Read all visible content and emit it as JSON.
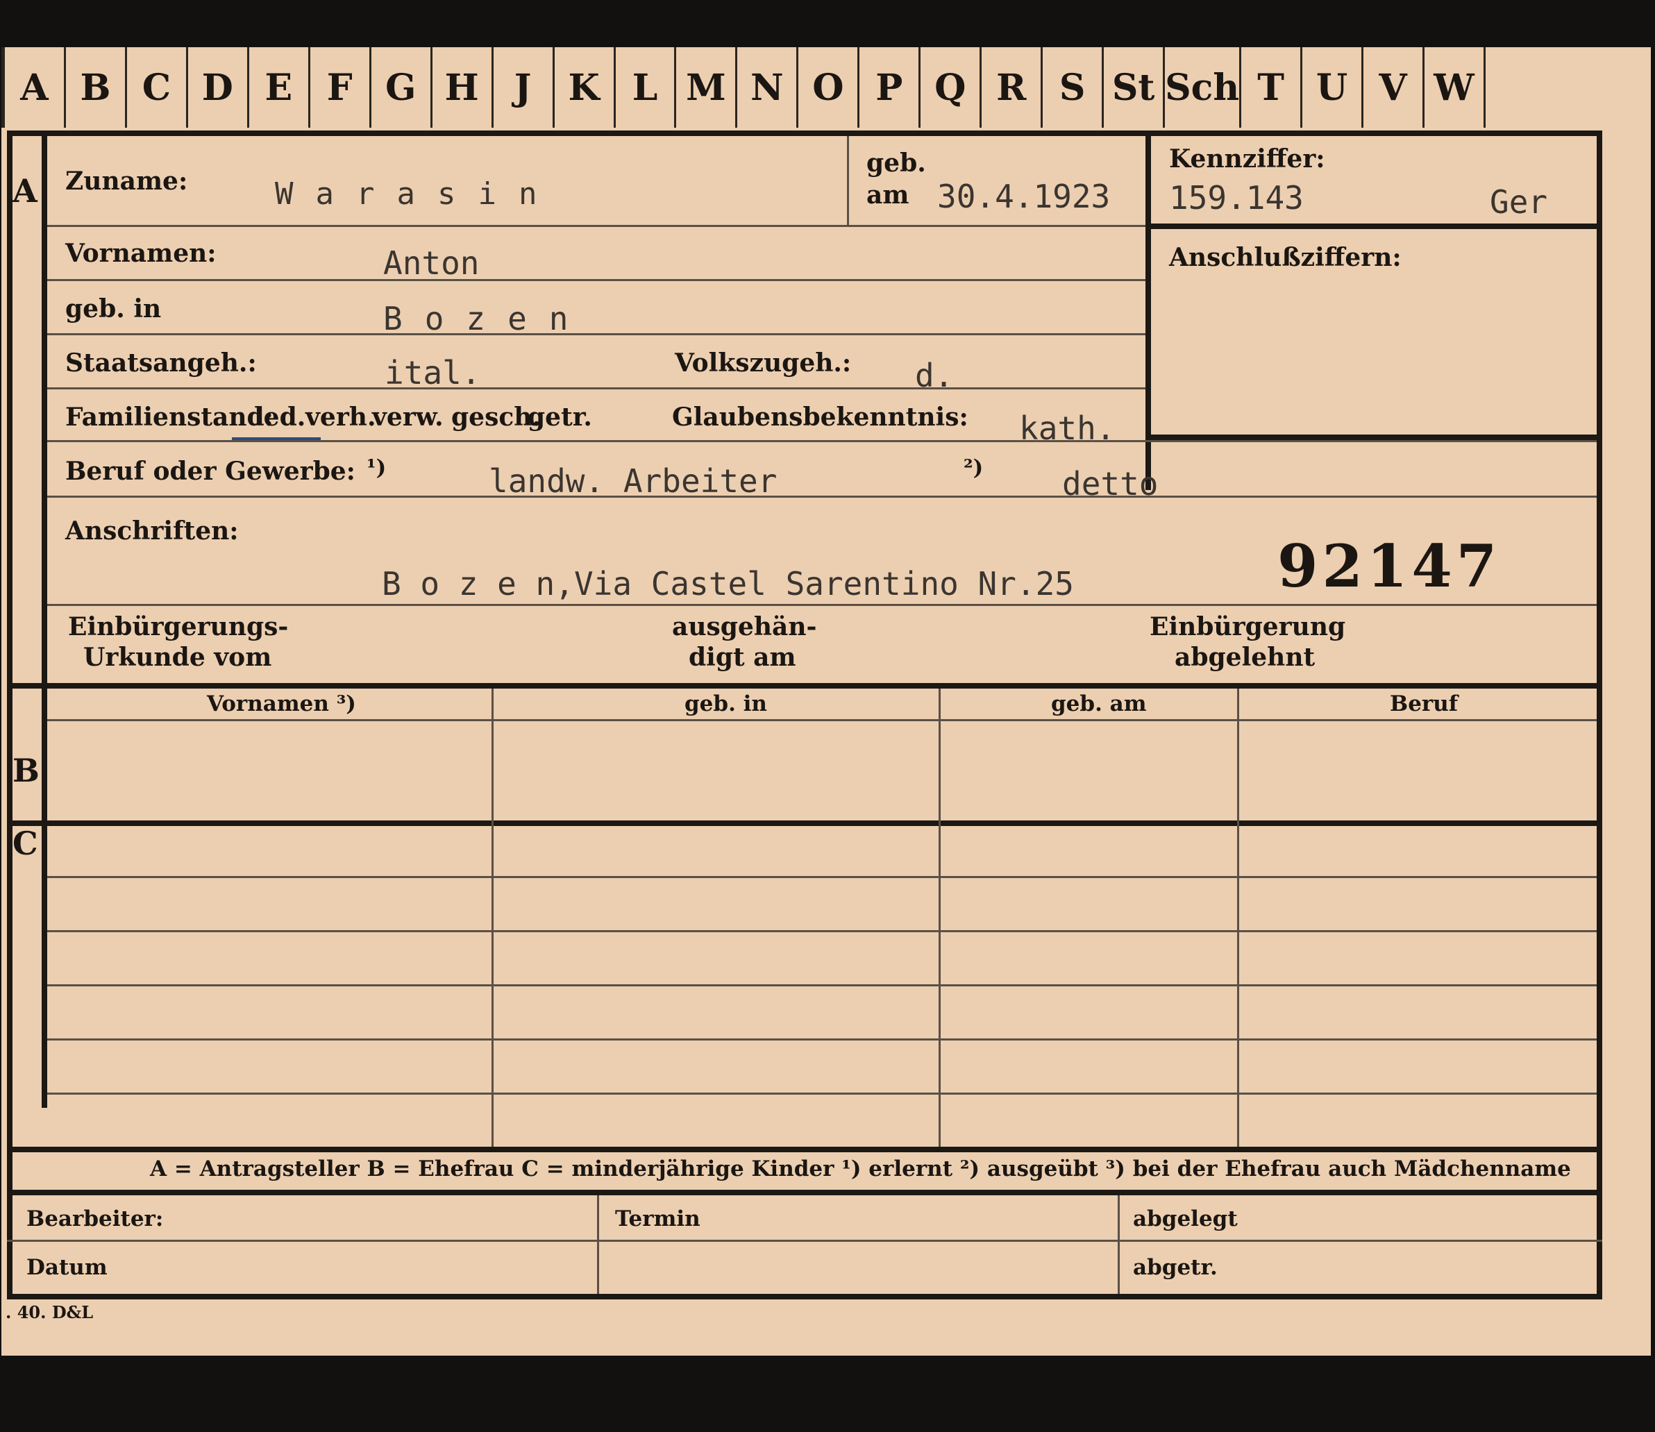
{
  "tabs": [
    "A",
    "B",
    "C",
    "D",
    "E",
    "F",
    "G",
    "H",
    "J",
    "K",
    "L",
    "M",
    "N",
    "O",
    "P",
    "Q",
    "R",
    "S",
    "St",
    "Sch",
    "T",
    "U",
    "V",
    "W"
  ],
  "sections": {
    "a": "A",
    "b": "B",
    "c": "C"
  },
  "header": {
    "zuname_label": "Zuname:",
    "zuname_value": "Warasin",
    "geb_label": "geb.",
    "am_label": "am",
    "geb_am_value": "30.4.1923",
    "kennziffer_label": "Kennziffer:",
    "kennziffer_value": "159.143",
    "kennziffer_suffix": "Ger",
    "anschluss_label": "Anschlußziffern:"
  },
  "person": {
    "vornamen_label": "Vornamen:",
    "vornamen_value": "Anton",
    "geb_in_label": "geb. in",
    "geb_in_value": "Bozen",
    "staat_label": "Staatsangeh.:",
    "staat_value": "ital.",
    "volk_label": "Volkszugeh.:",
    "volk_value": "d.",
    "familienstand_label": "Familienstand:",
    "familienstand_options": [
      "led.",
      "verh.",
      "verw.",
      "gesch.",
      "getr."
    ],
    "glauben_label": "Glaubensbekenntnis:",
    "glauben_value": "kath.",
    "beruf_label": "Beruf oder Gewerbe:",
    "beruf_note1": "¹)",
    "beruf_value1": "landw. Arbeiter",
    "beruf_note2": "²)",
    "beruf_value2": "detto",
    "anschriften_label": "Anschriften:",
    "anschrift_value": "B o z e n,Via Castel Sarentino Nr.25",
    "stamp_number": "92147",
    "einb_urkunde_l1": "Einbürgerungs-",
    "einb_urkunde_l2": "Urkunde vom",
    "ausgehaendigt_l1": "ausgehän-",
    "ausgehaendigt_l2": "digt am",
    "einb_abgelehnt_l1": "Einbürgerung",
    "einb_abgelehnt_l2": "abgelehnt"
  },
  "family_table": {
    "columns": [
      "Vornamen ³)",
      "geb. in",
      "geb. am",
      "Beruf"
    ]
  },
  "legend": "A = Antragsteller   B = Ehefrau   C = minderjährige Kinder   ¹) erlernt   ²) ausgeübt   ³) bei der Ehefrau auch Mädchenname",
  "footer": {
    "bearbeiter": "Bearbeiter:",
    "termin": "Termin",
    "abgelegt": "abgelegt",
    "datum": "Datum",
    "abgetr": "abgetr."
  },
  "imprint": ". 40. D&L"
}
